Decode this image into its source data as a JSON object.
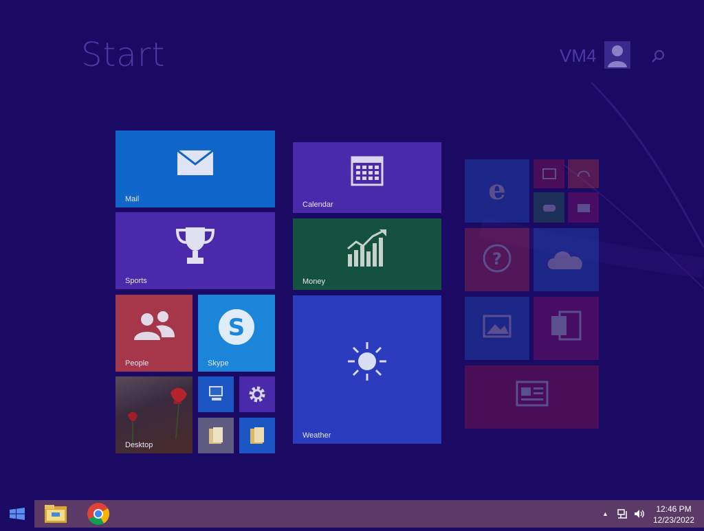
{
  "start_screen": {
    "title": "Start",
    "user_name": "VM4"
  },
  "tiles": {
    "mail": "Mail",
    "sports": "Sports",
    "people": "People",
    "skype": "Skype",
    "desktop": "Desktop",
    "calendar": "Calendar",
    "money": "Money",
    "weather": "Weather"
  },
  "colors": {
    "background": "#1b0a64",
    "mail_tile": "#1166c9",
    "sports_tile": "#4a2aab",
    "people_tile": "#a6374b",
    "skype_tile": "#1b86d9",
    "calendar_tile": "#4a2aab",
    "money_tile": "#14513f",
    "weather_tile": "#2a3bbd",
    "taskbar": "#5c3a67"
  },
  "icons": {
    "start": "windows-logo-icon",
    "explorer": "file-explorer-icon",
    "chrome": "chrome-icon",
    "network": "network-icon",
    "volume": "volume-icon"
  },
  "taskbar": {
    "tray_expand": "▲",
    "time": "12:46 PM",
    "date": "12/23/2022"
  }
}
